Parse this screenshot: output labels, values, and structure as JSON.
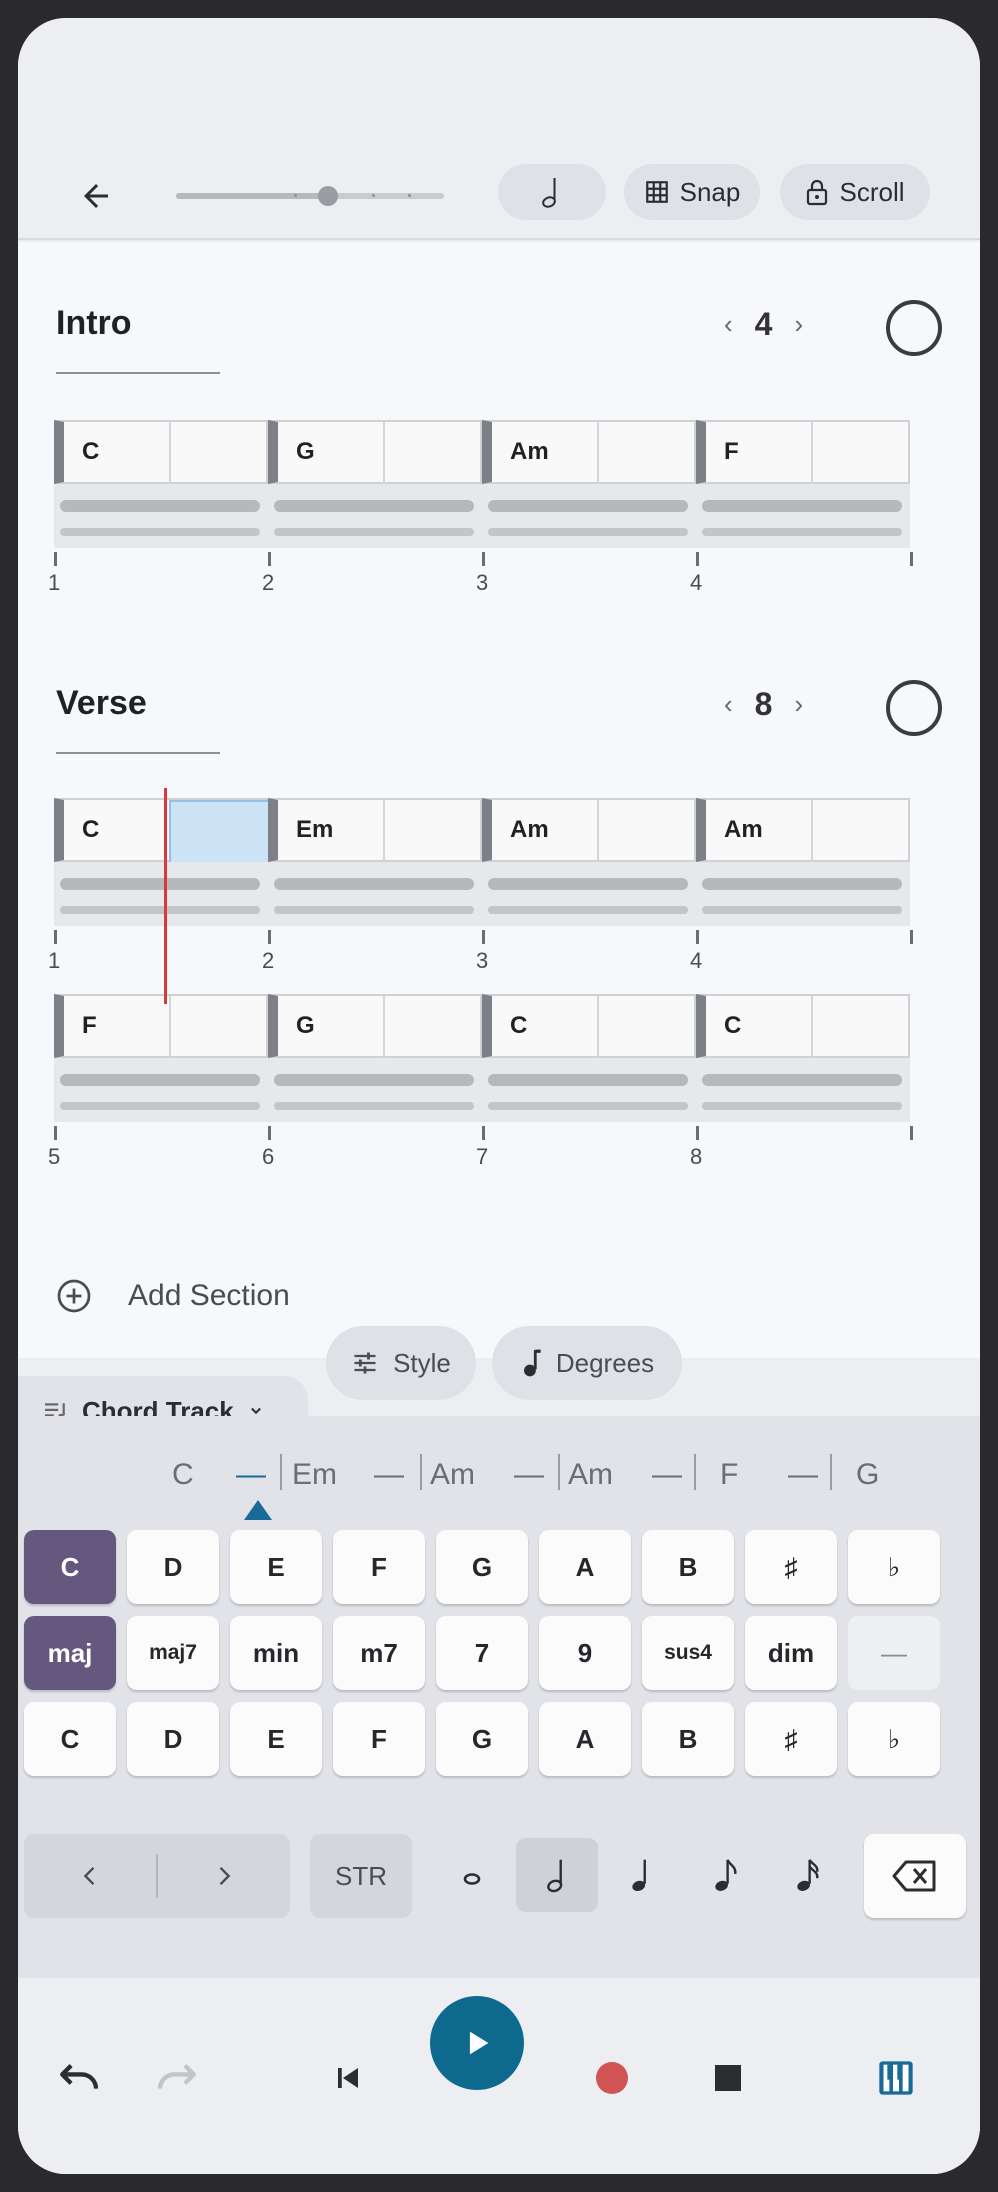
{
  "toolbar": {
    "tempo_slider_fraction": 0.57,
    "note_value_icon": "half-note-icon",
    "snap_label": "Snap",
    "scroll_label": "Scroll"
  },
  "sections": [
    {
      "title": "Intro",
      "bar_count": "4",
      "chords": [
        "C",
        "G",
        "Am",
        "F"
      ],
      "bar_numbers": [
        "1",
        "2",
        "3",
        "4"
      ]
    },
    {
      "title": "Verse",
      "bar_count": "8",
      "chords": [
        "C",
        "Em",
        "Am",
        "Am",
        "F",
        "G",
        "C",
        "C"
      ],
      "bar_numbers": [
        "1",
        "2",
        "3",
        "4",
        "5",
        "6",
        "7",
        "8"
      ]
    }
  ],
  "add_section_label": "Add Section",
  "tabs": {
    "chord_track_label": "Chord Track",
    "style_label": "Style",
    "degrees_label": "Degrees"
  },
  "chord_strip": [
    "C",
    "—",
    "Em",
    "—",
    "Am",
    "—",
    "Am",
    "—",
    "F",
    "—",
    "G"
  ],
  "keys": {
    "roots": [
      "C",
      "D",
      "E",
      "F",
      "G",
      "A",
      "B",
      "♯",
      "♭"
    ],
    "qualities": [
      "maj",
      "maj7",
      "min",
      "m7",
      "7",
      "9",
      "sus4",
      "dim",
      "—"
    ],
    "bass": [
      "C",
      "D",
      "E",
      "F",
      "G",
      "A",
      "B",
      "♯",
      "♭"
    ]
  },
  "edit": {
    "str_label": "STR"
  },
  "colors": {
    "accent_selected": "#64587e",
    "play_button": "#0d6a8e",
    "record": "#d05454",
    "playhead": "#d63a3a"
  }
}
